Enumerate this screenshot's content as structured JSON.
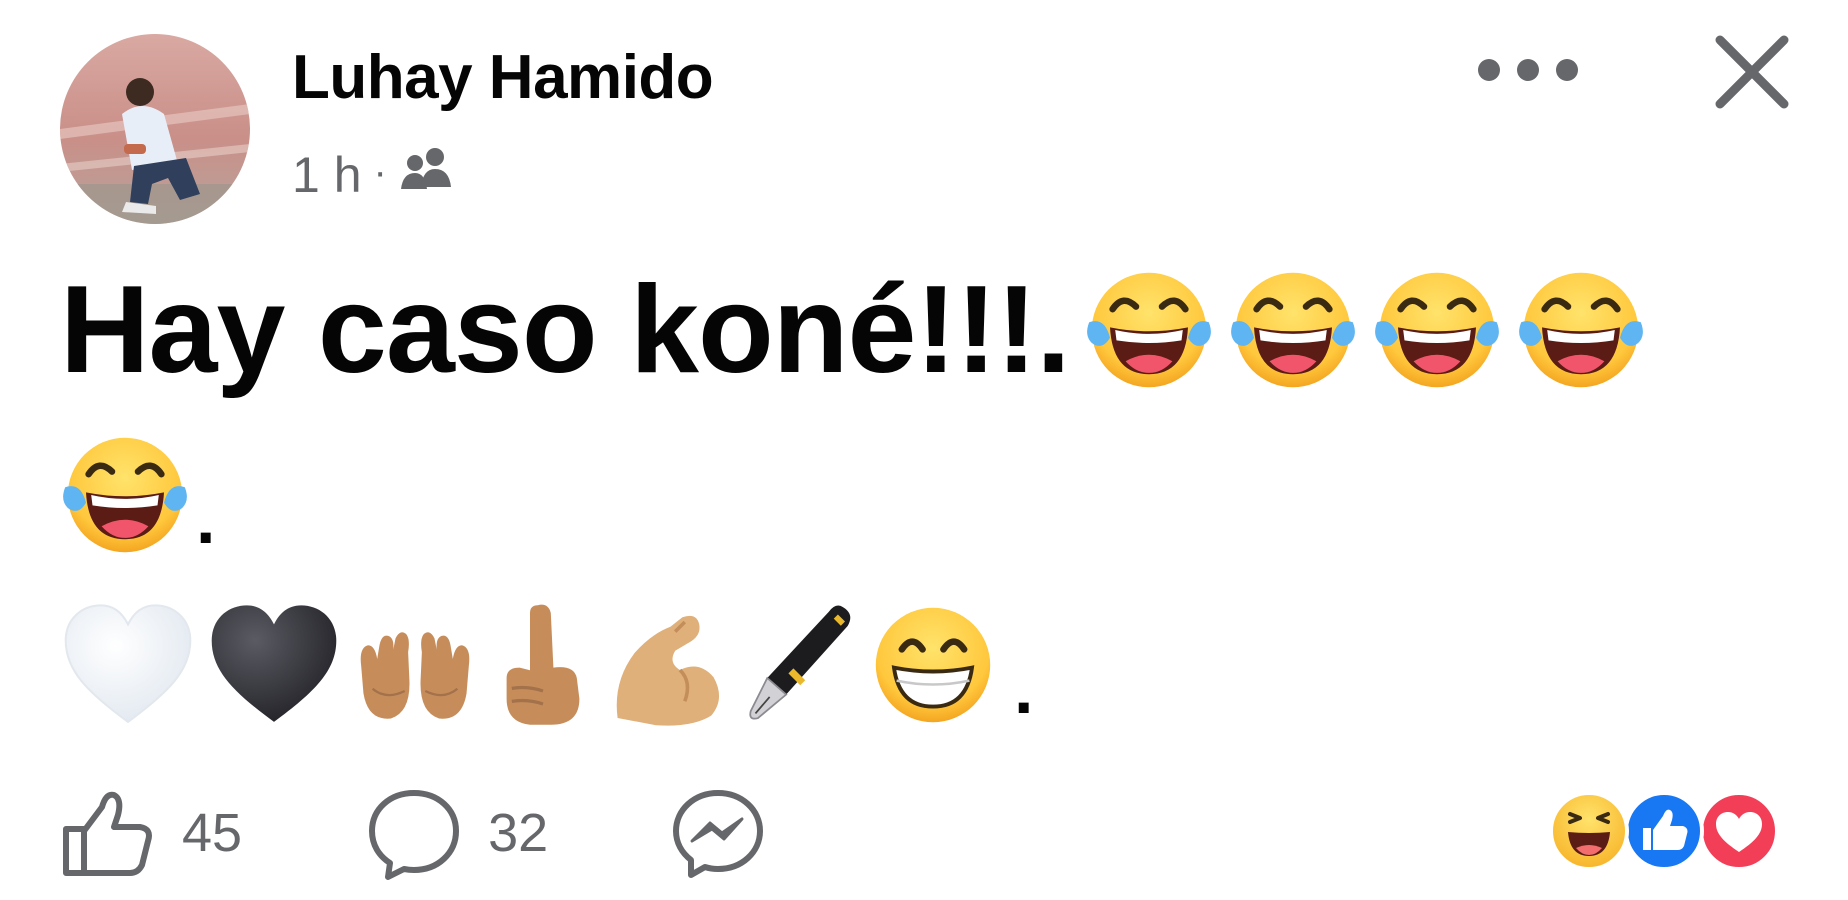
{
  "post": {
    "author_name": "Luhay Hamido",
    "timestamp": "1 h",
    "separator": "·",
    "audience_icon": "friends-icon",
    "text": "Hay caso koné!!!.",
    "period": ".",
    "line1_emojis": [
      "face-with-tears-of-joy",
      "face-with-tears-of-joy",
      "face-with-tears-of-joy",
      "face-with-tears-of-joy"
    ],
    "line2_emojis": [
      "face-with-tears-of-joy"
    ],
    "line3_emojis": [
      "white-heart",
      "black-heart",
      "palms-up-together-medium-skin",
      "index-pointing-up-medium-skin",
      "flexed-biceps-medium-light-skin",
      "fountain-pen",
      "beaming-face"
    ]
  },
  "footer": {
    "like_count": "45",
    "comment_count": "32",
    "share_icon": "messenger-icon",
    "reactions": [
      "haha",
      "like",
      "love"
    ]
  },
  "colors": {
    "text_primary": "#050505",
    "text_secondary": "#65676b",
    "like_blue": "#1877f2",
    "love_red": "#f33e58",
    "emoji_yellow": "#ffc83d"
  }
}
